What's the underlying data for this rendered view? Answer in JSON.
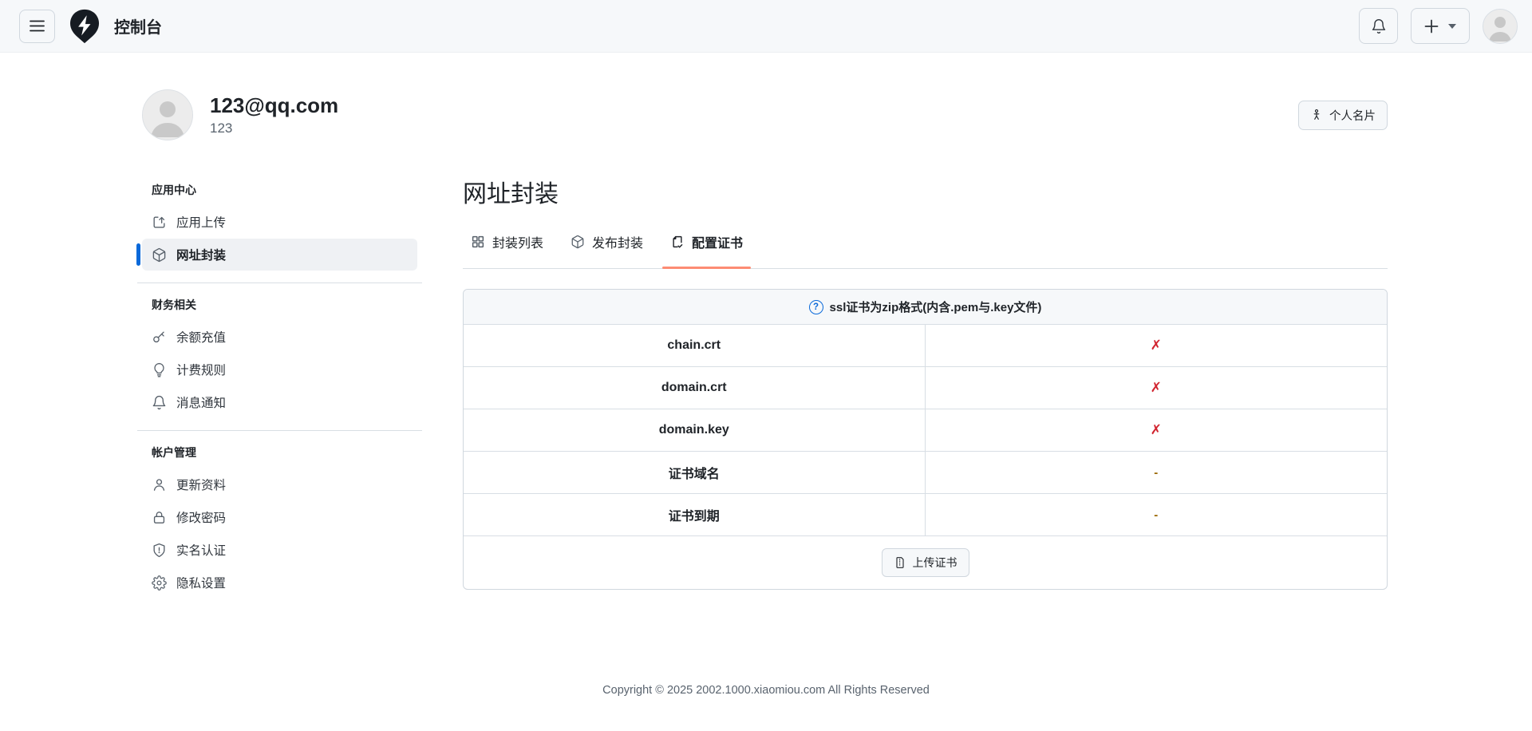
{
  "header": {
    "title": "控制台",
    "icons": [
      "hamburger-icon",
      "logo-pin-bolt-icon",
      "bell-icon",
      "plus-icon",
      "caret-down-icon",
      "avatar"
    ]
  },
  "profile": {
    "email": "123@qq.com",
    "username": "123",
    "card_button_label": "个人名片"
  },
  "sidebar": {
    "sections": [
      {
        "heading": "应用中心",
        "items": [
          {
            "label": "应用上传",
            "icon": "app-upload-icon",
            "active": false
          },
          {
            "label": "网址封装",
            "icon": "cube-icon",
            "active": true
          }
        ]
      },
      {
        "heading": "财务相关",
        "items": [
          {
            "label": "余额充值",
            "icon": "key-icon",
            "active": false
          },
          {
            "label": "计费规则",
            "icon": "lightbulb-icon",
            "active": false
          },
          {
            "label": "消息通知",
            "icon": "bell-icon",
            "active": false
          }
        ]
      },
      {
        "heading": "帐户管理",
        "items": [
          {
            "label": "更新资料",
            "icon": "person-icon",
            "active": false
          },
          {
            "label": "修改密码",
            "icon": "lock-icon",
            "active": false
          },
          {
            "label": "实名认证",
            "icon": "shield-icon",
            "active": false
          },
          {
            "label": "隐私设置",
            "icon": "gear-icon",
            "active": false
          }
        ]
      }
    ]
  },
  "main": {
    "title": "网址封装",
    "tabs": [
      {
        "label": "封装列表",
        "icon": "grid-icon",
        "active": false
      },
      {
        "label": "发布封装",
        "icon": "cube-icon",
        "active": false
      },
      {
        "label": "配置证书",
        "icon": "file-check-icon",
        "active": true
      }
    ],
    "table": {
      "header_note": "ssl证书为zip格式(内含.pem与.key文件)",
      "rows": [
        {
          "name": "chain.crt",
          "status": "✗",
          "status_type": "missing"
        },
        {
          "name": "domain.crt",
          "status": "✗",
          "status_type": "missing"
        },
        {
          "name": "domain.key",
          "status": "✗",
          "status_type": "missing"
        },
        {
          "name": "证书域名",
          "status": "-",
          "status_type": "empty"
        },
        {
          "name": "证书到期",
          "status": "-",
          "status_type": "empty"
        }
      ],
      "upload_button_label": "上传证书"
    }
  },
  "footer": {
    "copyright": "Copyright © 2025 2002.1000.xiaomiou.com All Rights Reserved"
  },
  "colors": {
    "accent_blue": "#0969da",
    "tab_underline": "#fd8c73",
    "status_missing": "#d1242f",
    "status_empty": "#9a6700",
    "topbar_bg": "#f6f8fa",
    "border": "#d0d7de"
  }
}
